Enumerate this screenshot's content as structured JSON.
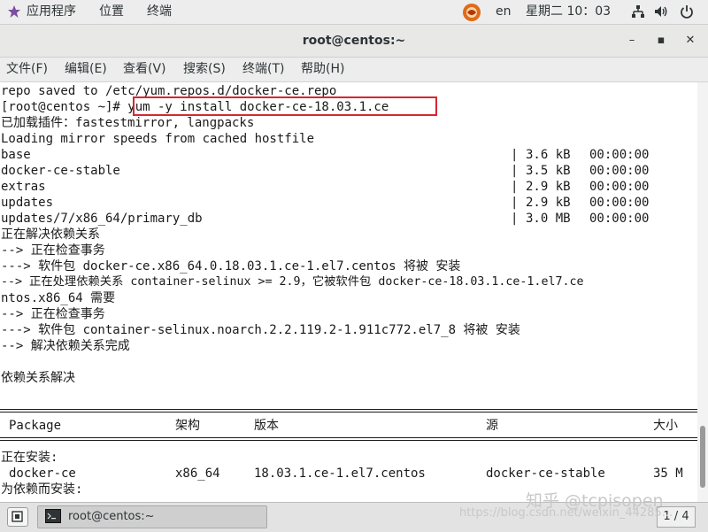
{
  "topbar": {
    "applications": "应用程序",
    "places": "位置",
    "terminal": "终端",
    "lang": "en",
    "clock": "星期二 10：03",
    "icons": [
      "apps-menu-icon",
      "app-indicator-icon",
      "network-icon",
      "volume-icon",
      "power-icon"
    ]
  },
  "window": {
    "title": "root@centos:~",
    "minimize": "–",
    "maximize": "▪",
    "close": "✕"
  },
  "menubar": {
    "items": [
      "文件(F)",
      "编辑(E)",
      "查看(V)",
      "搜索(S)",
      "终端(T)",
      "帮助(H)"
    ]
  },
  "terminal": {
    "lines": [
      "repo saved to /etc/yum.repos.d/docker-ce.repo",
      "[root@centos ~]# yum -y install docker-ce-18.03.1.ce",
      "已加载插件：fastestmirror, langpacks",
      "Loading mirror speeds from cached hostfile",
      "正在解决依赖关系",
      "--> 正在检查事务",
      "---> 软件包 docker-ce.x86_64.0.18.03.1.ce-1.el7.centos 将被 安装",
      "--> 正在处理依赖关系 container-selinux >= 2.9，它被软件包 docker-ce-18.03.1.ce-1.el7.ce",
      "ntos.x86_64 需要",
      "--> 正在检查事务",
      "---> 软件包 container-selinux.noarch.2.2.119.2-1.911c772.el7_8 将被 安装",
      "--> 解决依赖关系完成",
      "依赖关系解决",
      "正在安装:",
      "为依赖而安装:"
    ],
    "repos": [
      {
        "name": "base",
        "sep": "|",
        "size": "3.6 kB",
        "time": "00:00:00"
      },
      {
        "name": "docker-ce-stable",
        "sep": "|",
        "size": "3.5 kB",
        "time": "00:00:00"
      },
      {
        "name": "extras",
        "sep": "|",
        "size": "2.9 kB",
        "time": "00:00:00"
      },
      {
        "name": "updates",
        "sep": "|",
        "size": "2.9 kB",
        "time": "00:00:00"
      },
      {
        "name": "updates/7/x86_64/primary_db",
        "sep": "|",
        "size": "3.0 MB",
        "time": "00:00:00"
      }
    ],
    "table_header": {
      "package": "Package",
      "arch": "架构",
      "version": "版本",
      "repo": "源",
      "size": "大小"
    },
    "table_row": {
      "package": "docker-ce",
      "arch": "x86_64",
      "version": "18.03.1.ce-1.el7.centos",
      "repo": "docker-ce-stable",
      "size": "35 M"
    }
  },
  "watermark": {
    "main": "知乎 @tcpisopen",
    "url": "https://blog.csdn.net/weixin_44285..."
  },
  "taskbar": {
    "task_label": "root@centos:~",
    "workspace": "1 / 4"
  },
  "colors": {
    "highlight": "#d8262f",
    "terminal_bg": "#ffffff",
    "terminal_fg": "#1a1a1a"
  }
}
